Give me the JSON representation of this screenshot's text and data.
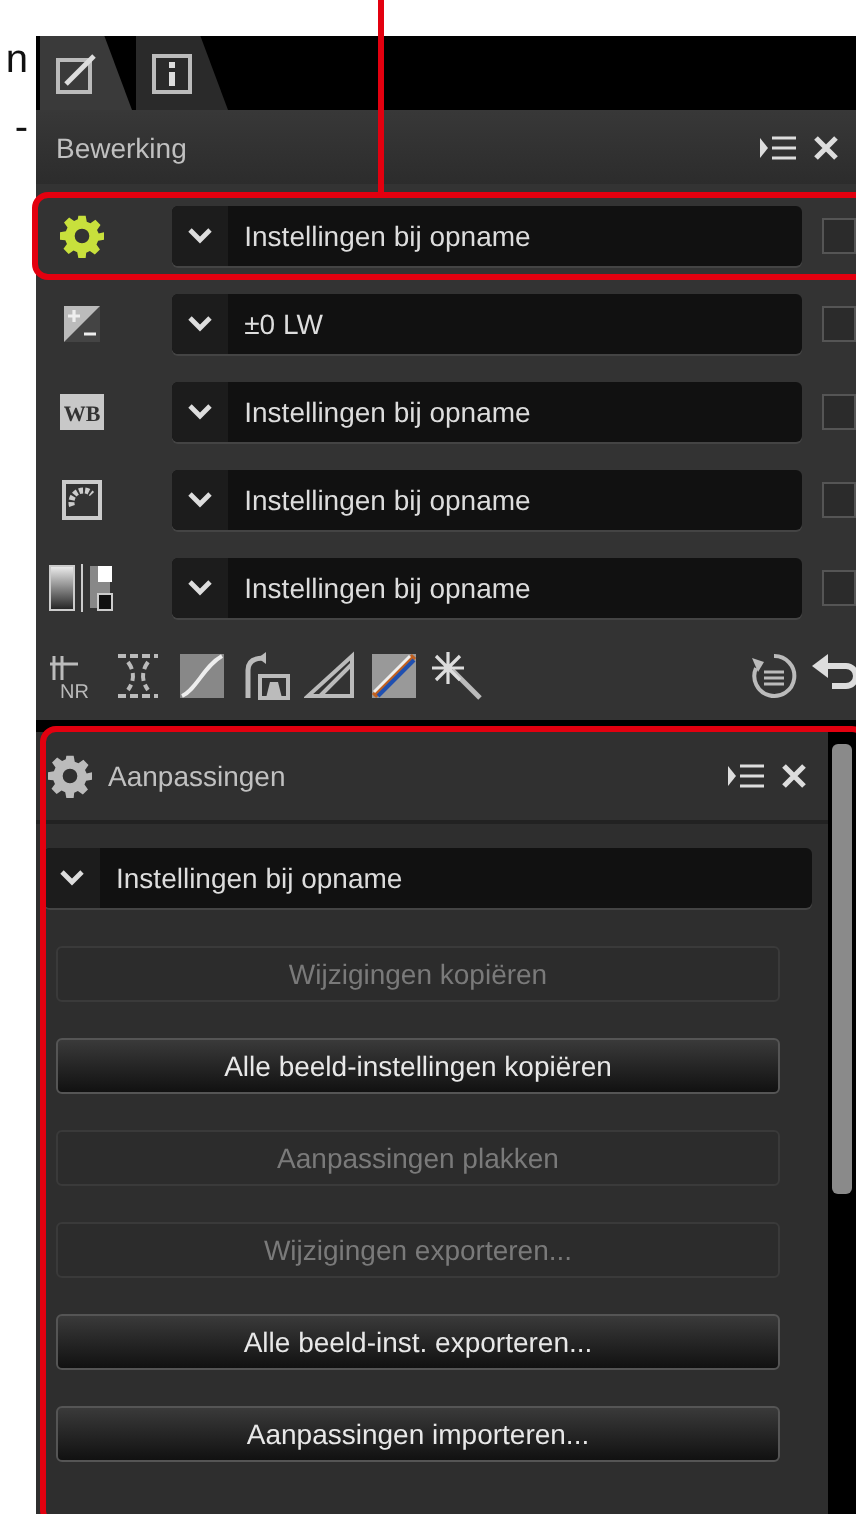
{
  "margin_text": [
    "n",
    "-"
  ],
  "tabs": [
    {
      "kind": "edit",
      "selected": true
    },
    {
      "kind": "info",
      "selected": false
    }
  ],
  "edit_panel": {
    "title": "Bewerking",
    "rows": [
      {
        "kind": "gear",
        "value": "Instellingen bij opname",
        "checked": false,
        "highlighted": true
      },
      {
        "kind": "exposure",
        "value": "±0 LW",
        "checked": false,
        "highlighted": false
      },
      {
        "kind": "wb",
        "icon_label": "WB",
        "value": "Instellingen bij opname",
        "checked": false,
        "highlighted": false
      },
      {
        "kind": "picture",
        "value": "Instellingen bij opname",
        "checked": false,
        "highlighted": false
      },
      {
        "kind": "tone",
        "value": "Instellingen bij opname",
        "checked": false,
        "highlighted": false
      }
    ]
  },
  "toolbar": {
    "noise_label": "NR"
  },
  "adjust_panel": {
    "title": "Aanpassingen",
    "highlighted": true,
    "preset": "Instellingen bij opname",
    "buttons": [
      {
        "label": "Wijzigingen kopiëren",
        "disabled": true
      },
      {
        "label": "Alle beeld-instellingen kopiëren",
        "disabled": false
      },
      {
        "label": "Aanpassingen plakken",
        "disabled": true
      },
      {
        "label": "Wijzigingen exporteren...",
        "disabled": true
      },
      {
        "label": "Alle beeld-inst. exporteren...",
        "disabled": false
      },
      {
        "label": "Aanpassingen importeren...",
        "disabled": false
      }
    ]
  }
}
